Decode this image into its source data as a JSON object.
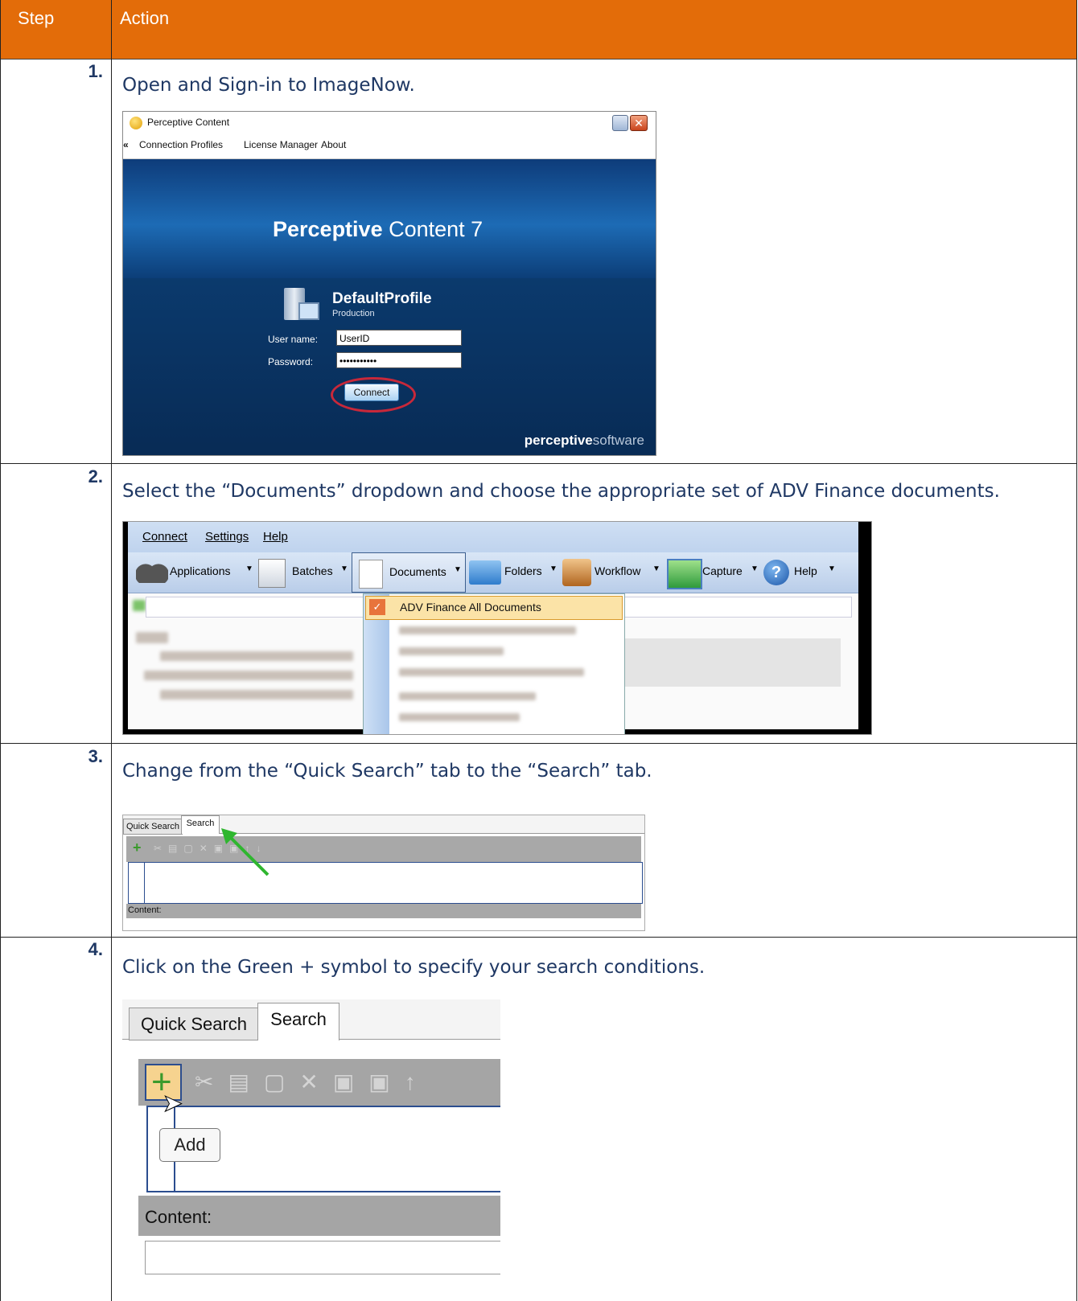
{
  "header": {
    "step_label": "Step",
    "action_label": "Action"
  },
  "steps": [
    {
      "num": "1.",
      "text": "Open and Sign-in to ImageNow."
    },
    {
      "num": "2.",
      "text": "Select the “Documents” dropdown and choose the appropriate set of ADV Finance documents."
    },
    {
      "num": "3.",
      "text": "Change from the “Quick Search” tab to the “Search” tab."
    },
    {
      "num": "4.",
      "text": "Click on the Green + symbol to specify your search conditions."
    }
  ],
  "login": {
    "window_title": "Perceptive Content",
    "menu_back": "«",
    "menu": [
      "Connection Profiles",
      "License Manager",
      "About"
    ],
    "brand_bold": "Perceptive",
    "brand_rest": " Content 7",
    "profile_name": "DefaultProfile",
    "profile_env": "Production",
    "username_label": "User name:",
    "username_value": "UserID",
    "password_label": "Password:",
    "password_value": "•••••••••••",
    "connect_button": "Connect",
    "footer_bold": "perceptive",
    "footer_rest": "software"
  },
  "docs_menu": {
    "menubar": [
      "Connect",
      "Settings",
      "Help"
    ],
    "toolbar": [
      "Applications",
      "Batches",
      "Documents",
      "Folders",
      "Workflow",
      "Capture",
      "Help"
    ],
    "selected_item": "ADV Finance All Documents"
  },
  "tabs_small": {
    "quick_search": "Quick Search",
    "search": "Search",
    "content_label": "Content:"
  },
  "tabs_large": {
    "quick_search": "Quick Search",
    "search": "Search",
    "tooltip": "Add",
    "content_label": "Content:"
  },
  "colors": {
    "header_bg": "#e36c09",
    "text_blue": "#1f3864"
  }
}
